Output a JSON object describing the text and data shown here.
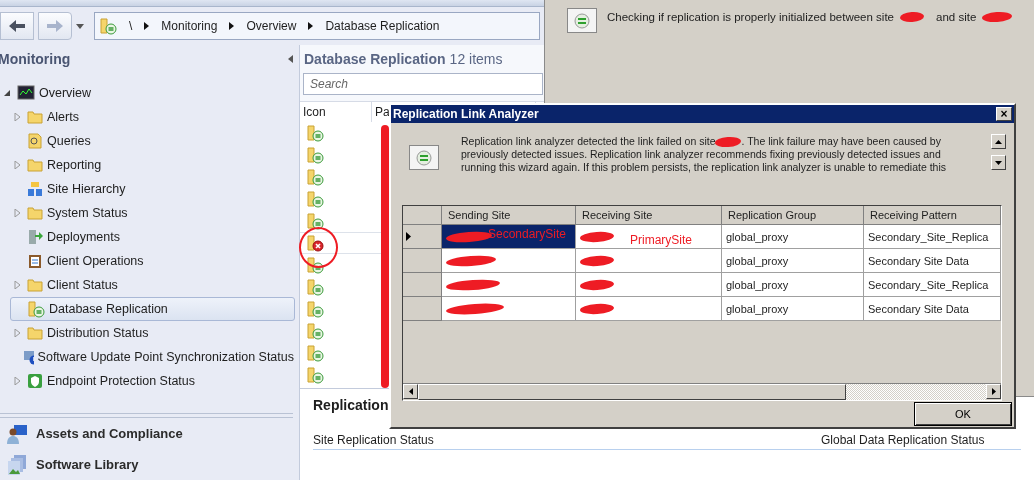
{
  "breadcrumb": {
    "items": [
      "\\",
      "Monitoring",
      "Overview",
      "Database Replication"
    ]
  },
  "navigation": {
    "title": "Monitoring",
    "items": [
      {
        "label": "Overview",
        "kind": "monitor",
        "expanded": true,
        "selected": false,
        "children": [
          {
            "label": "Alerts",
            "kind": "folder",
            "expanded": false,
            "selected": false
          },
          {
            "label": "Queries",
            "kind": "queries",
            "selected": false
          },
          {
            "label": "Reporting",
            "kind": "folder",
            "expanded": false,
            "selected": false
          },
          {
            "label": "Site Hierarchy",
            "kind": "hierarchy",
            "selected": false
          },
          {
            "label": "System Status",
            "kind": "folder",
            "expanded": false,
            "selected": false
          },
          {
            "label": "Deployments",
            "kind": "deployments",
            "selected": false
          },
          {
            "label": "Client Operations",
            "kind": "operations",
            "selected": false
          },
          {
            "label": "Client Status",
            "kind": "folder",
            "expanded": false,
            "selected": false
          },
          {
            "label": "Database Replication",
            "kind": "replication",
            "selected": true
          },
          {
            "label": "Distribution Status",
            "kind": "folder",
            "expanded": false,
            "selected": false
          },
          {
            "label": "Software Update Point Synchronization Status",
            "kind": "sync",
            "selected": false
          },
          {
            "label": "Endpoint Protection Status",
            "kind": "shield",
            "expanded": false,
            "selected": false
          }
        ]
      }
    ]
  },
  "workspaces": [
    {
      "label": "Assets and Compliance",
      "kind": "assets"
    },
    {
      "label": "Software Library",
      "kind": "library"
    }
  ],
  "list": {
    "title": "Database Replication",
    "count": "12 items",
    "search": {
      "placeholder": "Search"
    },
    "columns": [
      "Icon",
      "Pa"
    ],
    "rows": [
      {
        "kind": "ok"
      },
      {
        "kind": "ok"
      },
      {
        "kind": "ok"
      },
      {
        "kind": "ok"
      },
      {
        "kind": "ok"
      },
      {
        "kind": "error"
      },
      {
        "kind": "ok"
      },
      {
        "kind": "ok"
      },
      {
        "kind": "ok"
      },
      {
        "kind": "ok"
      },
      {
        "kind": "ok"
      },
      {
        "kind": "ok"
      }
    ]
  },
  "details": {
    "title": "Replication",
    "sections": [
      "Site Replication Status",
      "Global Data Replication Status"
    ]
  },
  "wizard": {
    "message_start": "Checking if replication is properly initialized between site",
    "message_end": "and site"
  },
  "dialog": {
    "title": "Replication Link Analyzer",
    "close": "×",
    "message_start": "Replication link analyzer detected the link failed on site",
    "message_lines": [
      ".  The link failure may have been caused by",
      "previously detected issues.  Replication link analyzer recommends fixing previously detected issues and",
      "running this wizard again.  If this problem persists, the replication link analyzer is unable to remediate this"
    ],
    "grid": {
      "columns": [
        "Sending Site",
        "Receiving Site",
        "Replication Group",
        "Receiving Pattern"
      ],
      "rows": [
        {
          "selected": true,
          "sending_note": "SecondarySite",
          "receiving_note": "PrimarySite",
          "replication_group": "global_proxy",
          "receiving_pattern": "Secondary_Site_Replica"
        },
        {
          "selected": false,
          "replication_group": "global_proxy",
          "receiving_pattern": "Secondary Site Data"
        },
        {
          "selected": false,
          "replication_group": "global_proxy",
          "receiving_pattern": "Secondary_Site_Replica"
        },
        {
          "selected": false,
          "replication_group": "global_proxy",
          "receiving_pattern": "Secondary Site Data"
        }
      ]
    },
    "buttons": [
      "OK"
    ]
  }
}
